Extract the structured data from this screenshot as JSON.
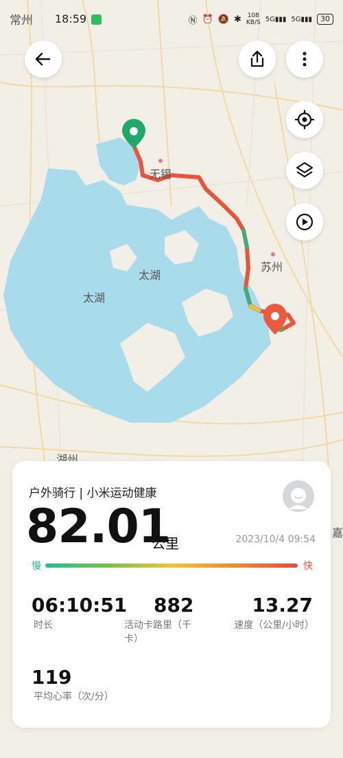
{
  "status_bar": {
    "city_label": "常州",
    "time": "18:59",
    "network_speed": "108\nKB/S",
    "network_type_1": "5G",
    "network_type_2": "5G",
    "battery": "30"
  },
  "map": {
    "labels": {
      "wuxi": "无锡",
      "suzhou": "苏州",
      "taihu_1": "太湖",
      "taihu_2": "太湖",
      "huzhou": "湖州",
      "jiaxing": "嘉"
    },
    "colors": {
      "water": "#a9dcea",
      "land": "#f2efe7",
      "road": "#f3d79a",
      "route_fast": "#e9543a",
      "route_slow": "#2ab58a",
      "start_pin": "#1ea86a",
      "end_pin": "#ec5a3e"
    }
  },
  "toolbar": {
    "back": "back-icon",
    "share": "share-icon",
    "more": "more-vertical-icon",
    "locate": "locate-icon",
    "layers": "layers-icon",
    "play": "play-icon"
  },
  "summary": {
    "title": "户外骑行 | 小米运动健康",
    "distance": "82.01",
    "distance_unit": "公里",
    "date": "2023/10/4 09:54",
    "slow_label": "慢",
    "fast_label": "快"
  },
  "stats": [
    {
      "value": "06:10:51",
      "label": "时长"
    },
    {
      "value": "882",
      "label": "活动卡路里（千卡）"
    },
    {
      "value": "13.27",
      "label": "速度（公里/小时）"
    },
    {
      "value": "119",
      "label": "平均心率（次/分）"
    }
  ]
}
